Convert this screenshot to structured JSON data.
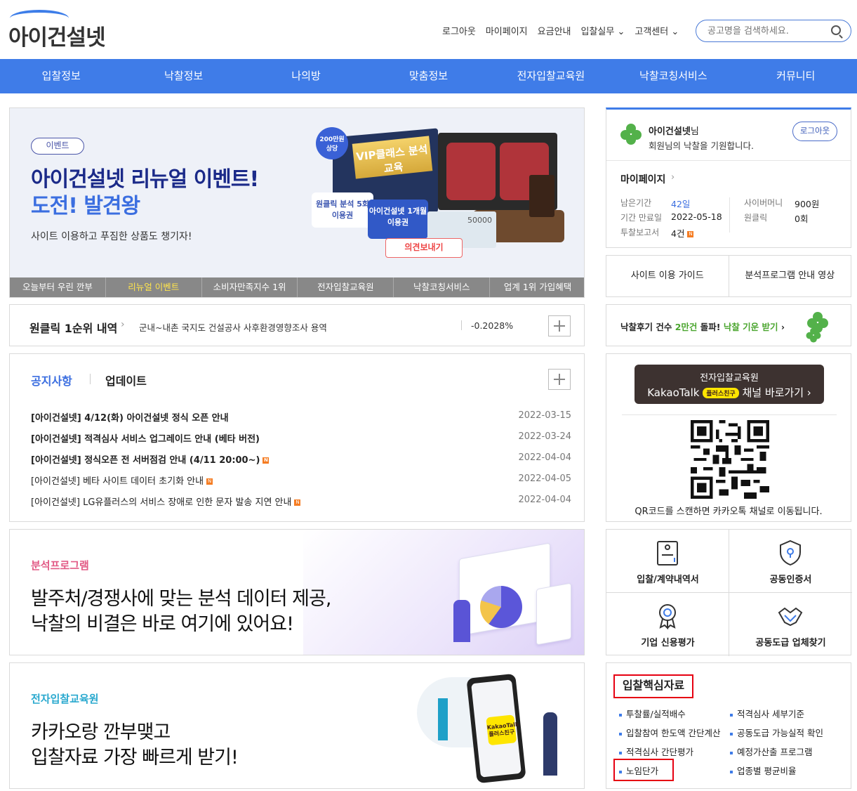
{
  "header": {
    "logo": "아이건설넷",
    "topnav": [
      "로그아웃",
      "마이페이지",
      "요금안내",
      "입찰실무 ⌄",
      "고객센터 ⌄"
    ],
    "search_placeholder": "공고명을 검색하세요."
  },
  "mainnav": [
    "입찰정보",
    "낙찰정보",
    "나의방",
    "맞춤정보",
    "전자입찰교육원",
    "낙찰코칭서비스",
    "커뮤니티"
  ],
  "banner": {
    "badge": "이벤트",
    "title1": "아이건설넷 리뉴얼 이벤트!",
    "title2": "도전! 발견왕",
    "subtitle": "사이트 이용하고 푸짐한 상품도 챙기자!",
    "gift_circle": "200만원 상당",
    "gift_gold": "VIP클래스 분석교육",
    "gift_card1": "원클릭 분석 5회 이용권",
    "gift_card2": "아이건설넷 1개월 이용권",
    "gift_bill": "50000",
    "gift_opinion": "의견보내기",
    "tabs": [
      "오늘부터 우린 깐부",
      "리뉴얼 이벤트",
      "소비자만족지수 1위",
      "전자입찰교육원",
      "낙찰코칭서비스",
      "업계 1위 가입혜택"
    ]
  },
  "oneclick": {
    "title": "원클릭 1순위 내역",
    "item": "군내~내촌 국지도 건설공사 사후환경영향조사 용역",
    "value": "-0.2028%"
  },
  "notice": {
    "tab_active": "공지사항",
    "tab_other": "업데이트",
    "rows": [
      {
        "title": "[아이건설넷] 4/12(화) 아이건설넷 정식 오픈 안내",
        "date": "2022-03-15"
      },
      {
        "title": "[아이건설넷] 적격심사 서비스 업그레이드 안내 (베타 버전)",
        "date": "2022-03-24"
      },
      {
        "title": "[아이건설넷] 정식오픈 전 서버점검 안내 (4/11 20:00~)",
        "date": "2022-04-04"
      },
      {
        "title": "[아이건설넷] 베타 사이트 데이터 초기화 안내",
        "date": "2022-04-05"
      },
      {
        "title": "[아이건설넷] LG유플러스의 서비스 장애로 인한 문자 발송 지연 안내",
        "date": "2022-04-04"
      }
    ],
    "new_badge": "N"
  },
  "promo1": {
    "label": "분석프로그램",
    "line1": "발주처/경쟁사에 맞는 분석 데이터 제공,",
    "line2": "낙찰의 비결은 바로 여기에 있어요!"
  },
  "promo2": {
    "label": "전자입찰교육원",
    "line1": "카카오랑 깐부맺고",
    "line2": "입찰자료 가장 빠르게 받기!",
    "phone_badge": "KakaoTalk 플러스친구"
  },
  "user": {
    "name": "아이건설넷",
    "name_suffix": "님",
    "wish": "회원님의 낙찰을 기원합니다.",
    "logout": "로그아웃",
    "mypage": "마이페이지",
    "remain_label": "남은기간",
    "remain_value": "42일",
    "expire_label": "기간 만료일",
    "expire_value": "2022-05-18",
    "report_label": "투찰보고서",
    "report_value": "4건",
    "money_label": "사이버머니",
    "money_value": "900원",
    "oneclick_label": "원클릭",
    "oneclick_value": "0회"
  },
  "guide": [
    "사이트 이용 가이드",
    "분석프로그램 안내 영상"
  ],
  "review": {
    "pre": "낙찰후기 건수 ",
    "highlight1": "2만건",
    "mid": " 돌파! ",
    "highlight2": "낙찰 기운 받기"
  },
  "kakao": {
    "line1": "전자입찰교육원",
    "brand": "KakaoTalk",
    "plus": "플러스친구",
    "line2": "채널 바로가기 ›",
    "qr_text": "QR코드를 스캔하면 카카오톡 채널로 이동됩니다."
  },
  "quick": [
    "입찰/계약내역서",
    "공동인증서",
    "기업 신용평가",
    "공동도급 업체찾기"
  ],
  "core": {
    "title": "입찰핵심자료",
    "items": [
      "투찰률/실적배수",
      "적격심사 세부기준",
      "입찰참여 한도액 간단계산",
      "공동도급 가능실적 확인",
      "적격심사 간단평가",
      "예정가산출 프로그램",
      "노임단가",
      "업종별 평균비율"
    ]
  },
  "colors": {
    "brand_blue": "#3f7ce8",
    "highlight_red": "#e60012",
    "kakao_yellow": "#fee500"
  }
}
